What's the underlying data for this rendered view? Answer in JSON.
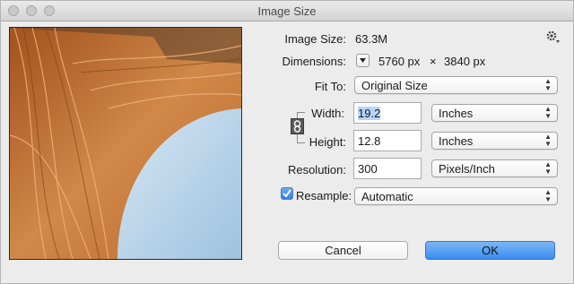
{
  "window": {
    "title": "Image Size"
  },
  "image_size": {
    "label": "Image Size:",
    "value": "63.3M"
  },
  "dimensions": {
    "label": "Dimensions:",
    "width": "5760 px",
    "times": "×",
    "height": "3840 px"
  },
  "fit_to": {
    "label": "Fit To:",
    "value": "Original Size"
  },
  "width": {
    "label": "Width:",
    "value": "19.2",
    "unit": "Inches"
  },
  "height": {
    "label": "Height:",
    "value": "12.8",
    "unit": "Inches"
  },
  "resolution": {
    "label": "Resolution:",
    "value": "300",
    "unit": "Pixels/Inch"
  },
  "resample": {
    "label": "Resample:",
    "checked": true,
    "value": "Automatic"
  },
  "buttons": {
    "cancel": "Cancel",
    "ok": "OK"
  },
  "icons": {
    "settings": "gear-icon",
    "link": "chain-link-icon",
    "dropdown": "up-down-arrows-icon"
  }
}
